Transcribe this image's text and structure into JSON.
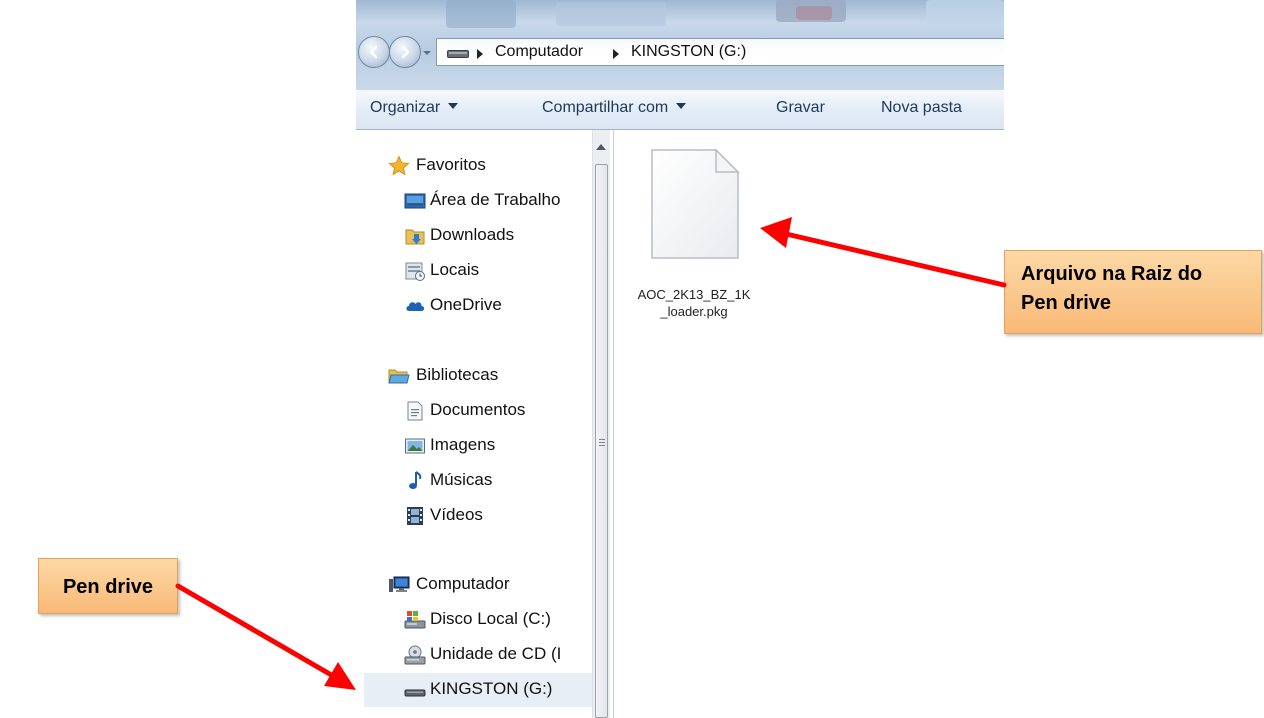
{
  "address_bar": {
    "crumbs": [
      "Computador",
      "KINGSTON (G:)"
    ]
  },
  "toolbar": {
    "organize": "Organizar",
    "share": "Compartilhar com",
    "burn": "Gravar",
    "new_folder": "Nova pasta"
  },
  "nav": {
    "favorites": {
      "label": "Favoritos",
      "items": [
        "Área de Trabalho",
        "Downloads",
        "Locais",
        "OneDrive"
      ]
    },
    "libraries": {
      "label": "Bibliotecas",
      "items": [
        "Documentos",
        "Imagens",
        "Músicas",
        "Vídeos"
      ]
    },
    "computer": {
      "label": "Computador",
      "items": [
        "Disco Local (C:)",
        "Unidade de CD (I",
        "KINGSTON (G:)"
      ]
    }
  },
  "content": {
    "file": {
      "name_line1": "AOC_2K13_BZ_1K",
      "name_line2": "_loader.pkg"
    }
  },
  "annotations": {
    "right_line1": "Arquivo na Raiz do",
    "right_line2": "Pen drive",
    "left": "Pen drive",
    "arrow_color": "#ff0000",
    "callout_color": "#f8b977"
  }
}
